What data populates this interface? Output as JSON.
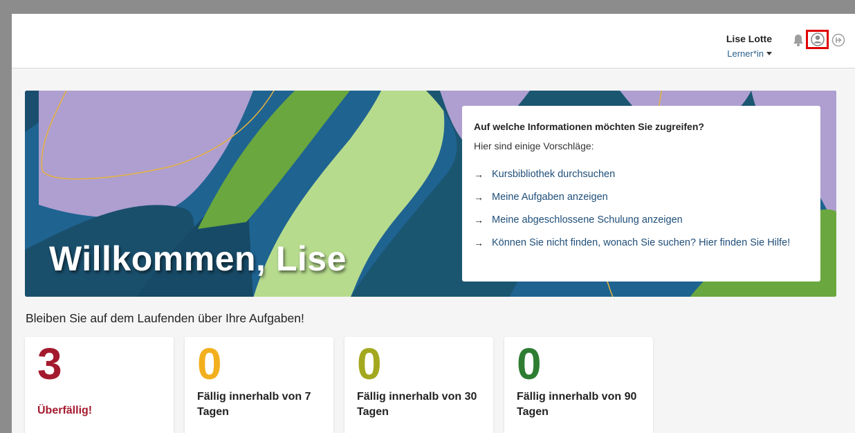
{
  "header": {
    "user_name": "Lise Lotte",
    "role": "Lerner*in"
  },
  "hero": {
    "title": "Willkommen, Lise"
  },
  "info_card": {
    "title": "Auf welche Informationen möchten Sie zugreifen?",
    "subtitle": "Hier sind einige Vorschläge:",
    "links": [
      "Kursbibliothek durchsuchen",
      "Meine Aufgaben anzeigen",
      "Meine abgeschlossene Schulung anzeigen",
      "Können Sie nicht finden, wonach Sie suchen? Hier finden Sie Hilfe!"
    ]
  },
  "tasks": {
    "heading": "Bleiben Sie auf dem Laufenden über Ihre Aufgaben!",
    "cards": [
      {
        "count": "3",
        "label": "Überfällig!",
        "color": "#a31a2e"
      },
      {
        "count": "0",
        "label": "Fällig innerhalb von 7 Tagen",
        "color": "#f2b01e"
      },
      {
        "count": "0",
        "label": "Fällig innerhalb von 30 Tagen",
        "color": "#a3a81e"
      },
      {
        "count": "0",
        "label": "Fällig innerhalb von 90 Tagen",
        "color": "#2e7d32"
      }
    ]
  },
  "icons": {
    "notifications": "bell-icon",
    "profile": "user-circle-icon",
    "logout": "logout-icon"
  }
}
